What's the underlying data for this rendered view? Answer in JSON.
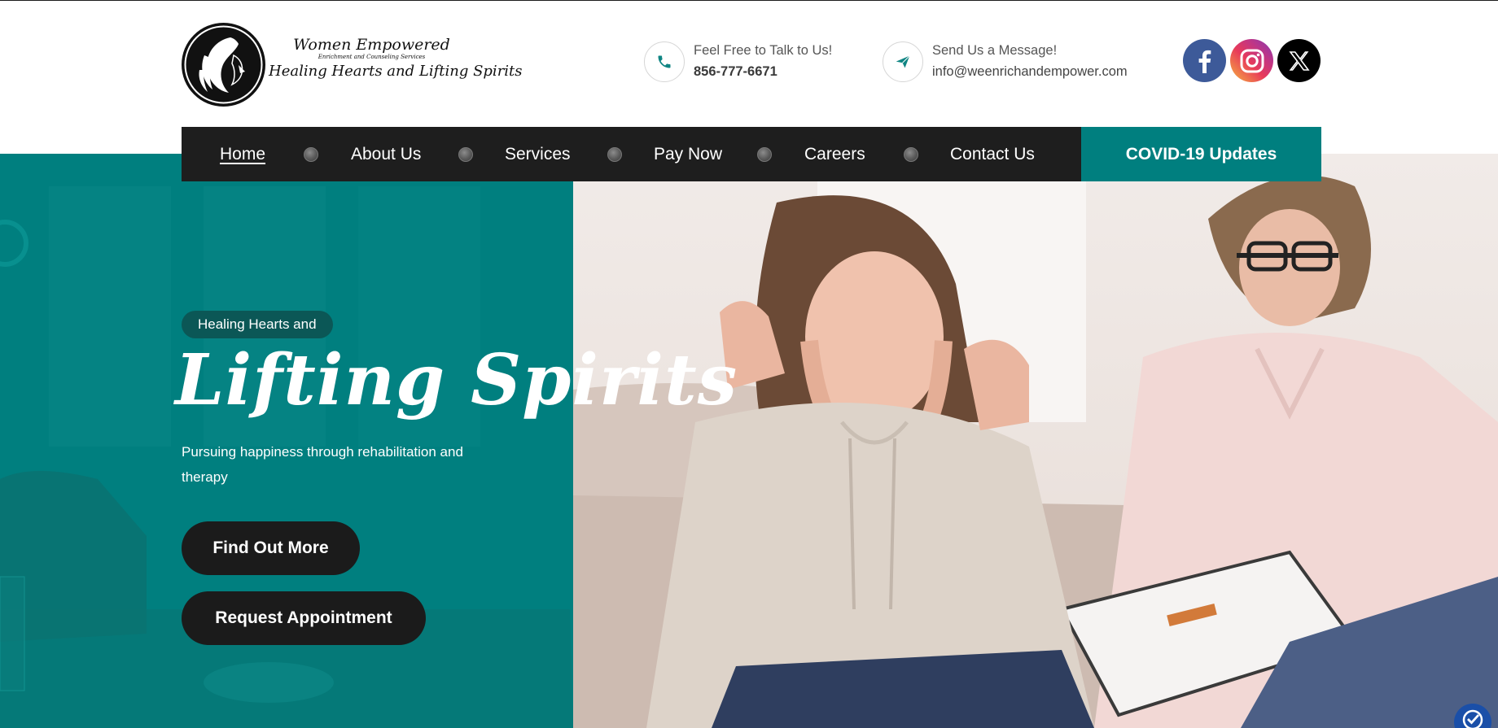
{
  "header": {
    "logo": {
      "line1": "Women Empowered",
      "line2": "Enrichment and Counseling Services",
      "line3": "Healing Hearts and Lifting Spirits"
    },
    "phone": {
      "icon": "phone-icon",
      "label": "Feel Free to Talk to Us!",
      "value": "856-777-6671"
    },
    "email": {
      "icon": "paper-plane-icon",
      "label": "Send Us a Message!",
      "value": "info@weenrichandempower.com"
    },
    "social": [
      {
        "name": "facebook-icon",
        "color": "#3d5a99"
      },
      {
        "name": "instagram-icon",
        "color": "#e83a5a"
      },
      {
        "name": "x-icon",
        "color": "#000000"
      }
    ]
  },
  "nav": {
    "items": [
      "Home",
      "About Us",
      "Services",
      "Pay Now",
      "Careers",
      "Contact Us"
    ],
    "active": "Home",
    "cta": "COVID-19 Updates"
  },
  "hero": {
    "pill": "Healing Hearts and",
    "title": "Lifting Spirits",
    "subtitle": "Pursuing happiness through rehabilitation and therapy",
    "buttons": {
      "find_out_more": "Find Out More",
      "request_appointment": "Request Appointment"
    },
    "photo": "therapy-session-photo"
  },
  "accessibility": {
    "icon": "accessibility-icon"
  },
  "colors": {
    "teal": "#007f7f",
    "dark": "#1e1e1e",
    "pill": "#0b5756",
    "white": "#ffffff"
  }
}
